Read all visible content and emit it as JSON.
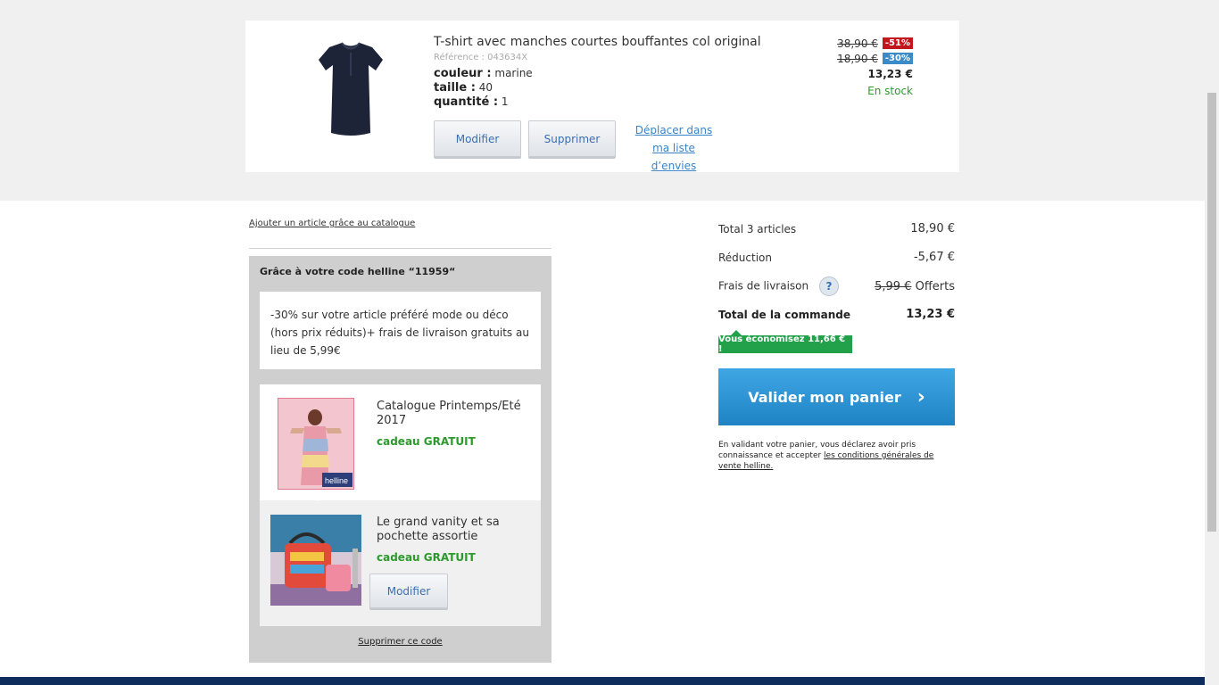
{
  "product": {
    "title": "T-shirt avec manches courtes bouffantes col original",
    "reference": "Référence : 043634X",
    "color_label": "couleur :",
    "color_value": "marine",
    "size_label": "taille :",
    "size_value": "40",
    "qty_label": "quantité :",
    "qty_value": "1",
    "modify_label": "Modifier",
    "delete_label": "Supprimer",
    "wishlist_line1": "Déplacer dans",
    "wishlist_line2": "ma liste d’envies",
    "price_original": "38,90 €",
    "discount1": "-51%",
    "price_intermediate": "18,90 €",
    "discount2": "-30%",
    "price_final": "13,23 €",
    "stock": "En stock"
  },
  "catalog_link": "Ajouter un article grâce au catalogue",
  "promo": {
    "title": "Grâce à votre code helline “11959“",
    "description": "-30% sur votre article préféré mode ou déco (hors prix réduits)+ frais de livraison gratuits au lieu de 5,99€",
    "gift1_name": "Catalogue Printemps/Eté 2017",
    "gift1_free": "cadeau GRATUIT",
    "gift1_brand": "helline",
    "gift2_name": "Le grand vanity et sa pochette assortie",
    "gift2_free": "cadeau GRATUIT",
    "gift2_modify": "Modifier",
    "delete_code": "Supprimer ce code"
  },
  "summary": {
    "total_items_label": "Total 3 articles",
    "total_items_value": "18,90 €",
    "reduction_label": "Réduction",
    "reduction_value": "-5,67 €",
    "shipping_label": "Frais de livraison",
    "shipping_help": "?",
    "shipping_old": "5,99 €",
    "shipping_value": "Offerts",
    "order_total_label": "Total de la commande",
    "order_total_value": "13,23 €",
    "savings": "Vous économisez 11,66 € !",
    "validate_label": "Valider mon panier",
    "validate_chevron": "›",
    "legal_text": "En validant votre panier, vous déclarez avoir pris connaissance et accepter ",
    "legal_link": "les conditions générales de vente helline."
  },
  "icons": {
    "product": "tshirt-image",
    "gift1": "catalogue-cover-image",
    "gift2": "vanity-bag-image"
  },
  "colors": {
    "accent_blue": "#2a93d5",
    "green": "#22a04a",
    "red_badge": "#c0181d",
    "blue_badge": "#3a8bc8",
    "footer": "#0f2d5c"
  }
}
